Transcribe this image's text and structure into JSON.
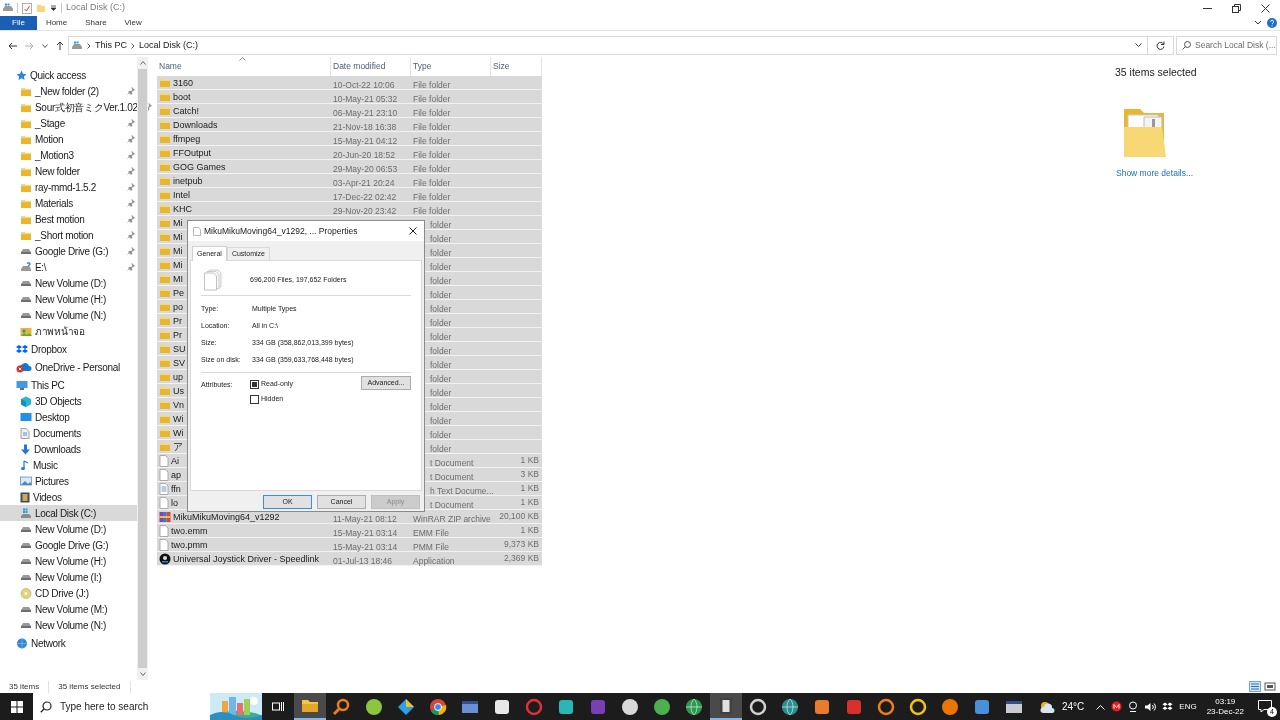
{
  "window": {
    "title": "Local Disk (C:)"
  },
  "ribbon_tabs": [
    {
      "label": "File",
      "kind": "file"
    },
    {
      "label": "Home",
      "kind": "tab"
    },
    {
      "label": "Share",
      "kind": "tab"
    },
    {
      "label": "View",
      "kind": "tab"
    }
  ],
  "address": {
    "segments": [
      "This PC",
      "Local Disk (C:)"
    ],
    "search_placeholder": "Search Local Disk (..."
  },
  "sidebar": {
    "items": [
      {
        "label": "Quick access",
        "kind": "star",
        "selected": false,
        "children": [
          {
            "label": "_New folder (2)",
            "kind": "folder",
            "pinned": true,
            "selected": false
          },
          {
            "label": "Sour式初音ミクVer.1.02",
            "kind": "folder",
            "pinned": true,
            "selected": false
          },
          {
            "label": "_Stage",
            "kind": "folder",
            "pinned": true,
            "selected": false
          },
          {
            "label": "Motion",
            "kind": "folder",
            "pinned": true,
            "selected": false
          },
          {
            "label": "_Motion3",
            "kind": "folder",
            "pinned": true,
            "selected": false
          },
          {
            "label": "New folder",
            "kind": "folder",
            "pinned": true,
            "selected": false
          },
          {
            "label": "ray-mmd-1.5.2",
            "kind": "folder",
            "pinned": true,
            "selected": false
          },
          {
            "label": "Materials",
            "kind": "folder",
            "pinned": true,
            "selected": false
          },
          {
            "label": "Best motion",
            "kind": "folder",
            "pinned": true,
            "selected": false
          },
          {
            "label": "_Short motion",
            "kind": "folder",
            "pinned": true,
            "selected": false
          },
          {
            "label": "Google Drive (G:)",
            "kind": "drive",
            "pinned": true,
            "selected": false
          },
          {
            "label": "E:\\",
            "kind": "unknown-drive",
            "pinned": true,
            "selected": false
          },
          {
            "label": "New Volume (D:)",
            "kind": "drive",
            "pinned": false,
            "selected": false
          },
          {
            "label": "New Volume (H:)",
            "kind": "drive",
            "pinned": false,
            "selected": false
          },
          {
            "label": "New Volume (N:)",
            "kind": "drive",
            "pinned": false,
            "selected": false
          },
          {
            "label": "ภาพหน้าจอ",
            "kind": "photos",
            "pinned": false,
            "selected": false
          }
        ]
      },
      {
        "label": "Dropbox",
        "kind": "dropbox",
        "selected": false
      },
      {
        "label": "OneDrive - Personal",
        "kind": "cloud",
        "selected": false
      },
      {
        "label": "This PC",
        "kind": "computer",
        "selected": false,
        "children": [
          {
            "label": "3D Objects",
            "kind": "cube",
            "selected": false
          },
          {
            "label": "Desktop",
            "kind": "desktop",
            "selected": false
          },
          {
            "label": "Documents",
            "kind": "documents",
            "selected": false
          },
          {
            "label": "Downloads",
            "kind": "downloads",
            "selected": false
          },
          {
            "label": "Music",
            "kind": "music",
            "selected": false
          },
          {
            "label": "Pictures",
            "kind": "pictures",
            "selected": false
          },
          {
            "label": "Videos",
            "kind": "videos",
            "selected": false
          },
          {
            "label": "Local Disk (C:)",
            "kind": "system-drive",
            "selected": true
          },
          {
            "label": "New Volume (D:)",
            "kind": "drive",
            "selected": false
          },
          {
            "label": "Google Drive (G:)",
            "kind": "drive",
            "selected": false
          },
          {
            "label": "New Volume (H:)",
            "kind": "drive",
            "selected": false
          },
          {
            "label": "New Volume (I:)",
            "kind": "drive",
            "selected": false
          },
          {
            "label": "CD Drive (J:)",
            "kind": "disc",
            "selected": false
          },
          {
            "label": "New Volume (M:)",
            "kind": "drive",
            "selected": false
          },
          {
            "label": "New Volume (N:)",
            "kind": "drive",
            "selected": false
          }
        ]
      },
      {
        "label": "Network",
        "kind": "network",
        "selected": false
      }
    ]
  },
  "columns": [
    {
      "label": "Name",
      "sorted": true
    },
    {
      "label": "Date modified",
      "sorted": false
    },
    {
      "label": "Type",
      "sorted": false
    },
    {
      "label": "Size",
      "sorted": false
    }
  ],
  "files": [
    {
      "name": "3160",
      "date": "10-Oct-22 10:06",
      "type": "File folder",
      "kind": "folder",
      "selected": true
    },
    {
      "name": "boot",
      "date": "10-May-21 05:32",
      "type": "File folder",
      "kind": "folder",
      "selected": true
    },
    {
      "name": "Catch!",
      "date": "06-May-21 23:10",
      "type": "File folder",
      "kind": "folder",
      "selected": true
    },
    {
      "name": "Downloads",
      "date": "21-Nov-18 16:38",
      "type": "File folder",
      "kind": "folder",
      "selected": true
    },
    {
      "name": "ffmpeg",
      "date": "15-May-21 04:12",
      "type": "File folder",
      "kind": "folder",
      "selected": true
    },
    {
      "name": "FFOutput",
      "date": "20-Jun-20 18:52",
      "type": "File folder",
      "kind": "folder",
      "selected": true
    },
    {
      "name": "GOG Games",
      "date": "29-May-20 06:53",
      "type": "File folder",
      "kind": "folder",
      "selected": true
    },
    {
      "name": "inetpub",
      "date": "03-Apr-21 20:24",
      "type": "File folder",
      "kind": "folder",
      "selected": true
    },
    {
      "name": "Intel",
      "date": "17-Dec-22 02:42",
      "type": "File folder",
      "kind": "folder",
      "selected": true
    },
    {
      "name": "KHC",
      "date": "29-Nov-20 23:42",
      "type": "File folder",
      "kind": "folder",
      "selected": true
    },
    {
      "name": "Mi",
      "type": "folder",
      "kind": "folder",
      "selected": true
    },
    {
      "name": "Mi",
      "type": "folder",
      "kind": "folder",
      "selected": true
    },
    {
      "name": "Mi",
      "type": "folder",
      "kind": "folder",
      "selected": true
    },
    {
      "name": "Mi",
      "type": "folder",
      "kind": "folder",
      "selected": true
    },
    {
      "name": "MI",
      "type": "folder",
      "kind": "folder",
      "selected": true
    },
    {
      "name": "Pe",
      "type": "folder",
      "kind": "folder",
      "selected": true
    },
    {
      "name": "po",
      "type": "folder",
      "kind": "folder",
      "selected": true
    },
    {
      "name": "Pr",
      "type": "folder",
      "kind": "folder",
      "selected": true
    },
    {
      "name": "Pr",
      "type": "folder",
      "kind": "folder",
      "selected": true
    },
    {
      "name": "SU",
      "type": "folder",
      "kind": "folder",
      "selected": true
    },
    {
      "name": "SV",
      "type": "folder",
      "kind": "folder",
      "selected": true
    },
    {
      "name": "up",
      "type": "folder",
      "kind": "folder",
      "selected": true
    },
    {
      "name": "Us",
      "type": "folder",
      "kind": "folder",
      "selected": true
    },
    {
      "name": "Vn",
      "type": "folder",
      "kind": "folder",
      "selected": true
    },
    {
      "name": "Wi",
      "type": "folder",
      "kind": "folder",
      "selected": true
    },
    {
      "name": "Wi",
      "type": "folder",
      "kind": "folder",
      "selected": true
    },
    {
      "name": "ア",
      "type": "folder",
      "kind": "folder",
      "selected": true
    },
    {
      "name": "Ai",
      "type": "t Document",
      "size": "1 KB",
      "kind": "blank",
      "selected": true
    },
    {
      "name": "ap",
      "type": "t Document",
      "size": "3 KB",
      "kind": "blank",
      "selected": true
    },
    {
      "name": "ffn",
      "type": "h Text Docume...",
      "size": "1 KB",
      "kind": "text",
      "selected": true
    },
    {
      "name": "lo",
      "type": "t Document",
      "size": "1 KB",
      "kind": "blank",
      "selected": true
    },
    {
      "name": "MikuMikuMoving64_v1292",
      "date": "11-May-21 08:12",
      "type": "WinRAR ZIP archive",
      "size": "20,100 KB",
      "kind": "archive",
      "selected": true
    },
    {
      "name": "two.emm",
      "date": "15-May-21 03:14",
      "type": "EMM File",
      "size": "1 KB",
      "kind": "blank",
      "selected": true
    },
    {
      "name": "two.pmm",
      "date": "15-May-21 03:14",
      "type": "PMM File",
      "size": "9,373 KB",
      "kind": "blank",
      "selected": true
    },
    {
      "name": "Universal Joystick Driver - Speedlink",
      "date": "01-Jul-13 18:46",
      "type": "Application",
      "size": "2,369 KB",
      "kind": "app",
      "selected": true
    }
  ],
  "details": {
    "title": "35 items selected",
    "link": "Show more details..."
  },
  "status_bar": {
    "count": "35 items",
    "selection": "35 items selected"
  },
  "dialog": {
    "title": "MikuMikuMoving64_v1292, ... Properties",
    "tabs": [
      {
        "label": "General",
        "selected": true
      },
      {
        "label": "Customize",
        "selected": false
      }
    ],
    "summary": "696,200 Files, 197,652 Folders",
    "fields": [
      {
        "label": "Type:",
        "value": "Multiple Types"
      },
      {
        "label": "Location:",
        "value": "All in C:\\"
      },
      {
        "label": "Size:",
        "value": "334 GB (358,862,013,399 bytes)"
      },
      {
        "label": "Size on disk:",
        "value": "334 GB (359,633,768,448 bytes)"
      }
    ],
    "attributes_label": "Attributes:",
    "attributes": [
      {
        "label": "Read-only",
        "indeterminate": true
      },
      {
        "label": "Hidden",
        "indeterminate": false
      }
    ],
    "advanced_button": "Advanced...",
    "buttons": [
      {
        "label": "OK",
        "kind": "default"
      },
      {
        "label": "Cancel",
        "kind": "normal"
      },
      {
        "label": "Apply",
        "kind": "disabled"
      }
    ]
  },
  "taskbar": {
    "search_placeholder": "Type here to search",
    "apps": [
      {
        "kind": "folder",
        "color": "#f4c542",
        "active": true
      },
      {
        "kind": "magnifier",
        "color": "#f07d1a",
        "active": false
      },
      {
        "kind": "circle",
        "color": "#8cc63f",
        "active": false
      },
      {
        "kind": "diamond",
        "color": "#2e9fe6",
        "active": false
      },
      {
        "kind": "chrome",
        "color": "#db4437",
        "active": false
      },
      {
        "kind": "window",
        "color": "#6b8fd6",
        "active": false
      },
      {
        "kind": "square",
        "color": "#e8e8e8",
        "active": false
      },
      {
        "kind": "ring",
        "color": "#e0303a",
        "active": false
      },
      {
        "kind": "square",
        "color": "#29b6b6",
        "active": false
      },
      {
        "kind": "square",
        "color": "#7b3fb5",
        "active": false
      },
      {
        "kind": "circle",
        "color": "#d8d8d8",
        "active": false
      },
      {
        "kind": "circle",
        "color": "#4caf50",
        "active": false
      },
      {
        "kind": "globe",
        "color": "#2d9a48",
        "active": false
      },
      {
        "kind": "film",
        "color": "#404040",
        "active": true
      },
      {
        "kind": "ring",
        "color": "#d0d0d0",
        "active": false
      },
      {
        "kind": "globe",
        "color": "#2a8f8f",
        "active": false
      },
      {
        "kind": "square",
        "color": "#e87b2c",
        "active": false
      },
      {
        "kind": "square",
        "color": "#d9302b",
        "active": false
      },
      {
        "kind": "ring",
        "color": "#f07d1a",
        "active": false
      },
      {
        "kind": "ring",
        "color": "#f2c21b",
        "active": false
      },
      {
        "kind": "circle",
        "color": "#ea7600",
        "active": false
      },
      {
        "kind": "square",
        "color": "#4a90d9",
        "active": false
      },
      {
        "kind": "window",
        "color": "#c8ccd0",
        "active": false
      }
    ],
    "weather": "24°C",
    "language": "ENG",
    "time": "03:19",
    "date": "23-Dec-22",
    "notifications": "4"
  }
}
